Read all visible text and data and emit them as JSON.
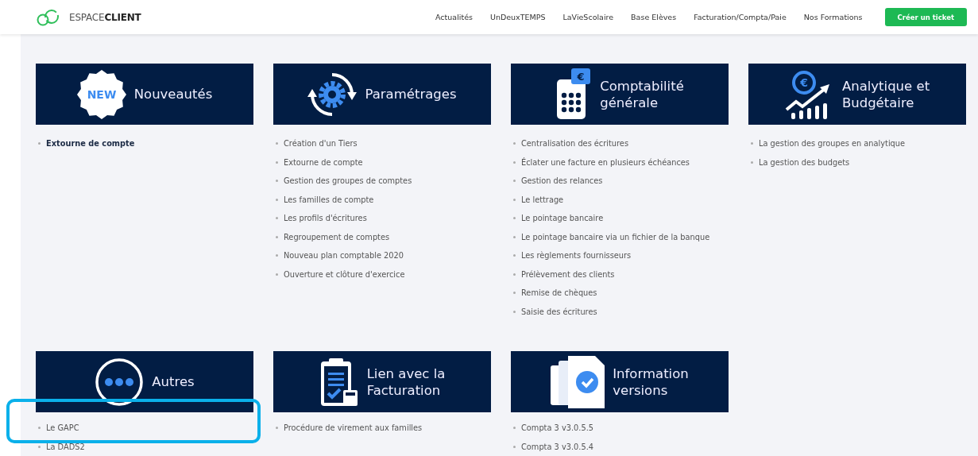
{
  "header": {
    "logo": {
      "light": "ESPACE",
      "bold": "CLIENT"
    },
    "nav": [
      "Actualités",
      "UnDeuxTEMPS",
      "LaVieScolaire",
      "Base Elèves",
      "Facturation/Compta/Paie",
      "Nos Formations"
    ],
    "cta": "Créer un ticket"
  },
  "sections": [
    {
      "title": [
        "Nouveautés"
      ],
      "kind": "new",
      "icon_text": "NEW",
      "items": [
        {
          "label": "Extourne de compte",
          "bold": true
        }
      ]
    },
    {
      "title": [
        "Paramétrages"
      ],
      "kind": "gear",
      "items": [
        {
          "label": "Création d'un Tiers",
          "bold": false
        },
        {
          "label": "Extourne de compte",
          "bold": false
        },
        {
          "label": "Gestion des groupes de comptes",
          "bold": false
        },
        {
          "label": "Les familles de compte",
          "bold": false
        },
        {
          "label": "Les profils d'écritures",
          "bold": false
        },
        {
          "label": "Regroupement de comptes",
          "bold": false
        },
        {
          "label": "Nouveau plan comptable 2020",
          "bold": false
        },
        {
          "label": "Ouverture et clôture d'exercice",
          "bold": false
        }
      ]
    },
    {
      "title": [
        "Comptabilité",
        "générale"
      ],
      "kind": "calculator",
      "icon_text": "€",
      "items": [
        {
          "label": "Centralisation des écritures",
          "bold": false
        },
        {
          "label": "Éclater une facture en plusieurs échéances",
          "bold": false
        },
        {
          "label": "Gestion des relances",
          "bold": false
        },
        {
          "label": "Le lettrage",
          "bold": false
        },
        {
          "label": "Le pointage bancaire",
          "bold": false
        },
        {
          "label": "Le pointage bancaire via un fichier de la banque",
          "bold": false
        },
        {
          "label": "Les règlements fournisseurs",
          "bold": false
        },
        {
          "label": "Prélèvement des clients",
          "bold": false
        },
        {
          "label": "Remise de chèques",
          "bold": false
        },
        {
          "label": "Saisie des écritures",
          "bold": false
        }
      ]
    },
    {
      "title": [
        "Analytique et",
        "Budgétaire"
      ],
      "kind": "chart",
      "icon_text": "€",
      "items": [
        {
          "label": "La gestion des groupes en analytique",
          "bold": false
        },
        {
          "label": "La gestion des budgets",
          "bold": false
        }
      ]
    },
    {
      "title": [
        "Autres"
      ],
      "kind": "dots",
      "items": [
        {
          "label": "Le GAPC",
          "bold": false
        },
        {
          "label": "La DADS2",
          "bold": false
        }
      ]
    },
    {
      "title": [
        "Lien avec la",
        "Facturation"
      ],
      "kind": "clipboard",
      "items": [
        {
          "label": "Procédure de virement aux familles",
          "bold": false
        }
      ]
    },
    {
      "title": [
        "Information",
        "versions"
      ],
      "kind": "documents",
      "items": [
        {
          "label": "Compta 3 v3.0.5.5",
          "bold": false
        },
        {
          "label": "Compta 3 v3.0.5.4",
          "bold": false
        }
      ]
    }
  ]
}
